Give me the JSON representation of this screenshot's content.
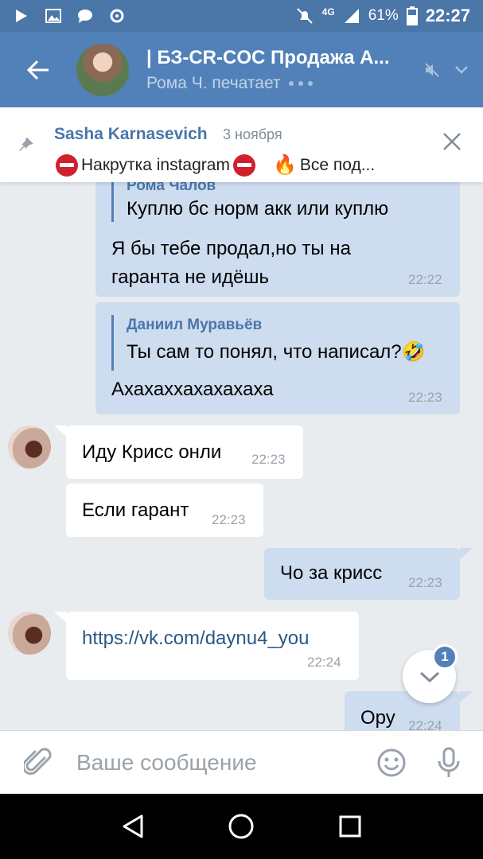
{
  "status_bar": {
    "network": "4G",
    "battery": "61%",
    "time": "22:27"
  },
  "header": {
    "title": "| БЗ-CR-COC Продажа А...",
    "subtitle": "Рома Ч. печатает"
  },
  "pinned": {
    "author": "Sasha Karnasevich",
    "date": "3 ноября",
    "text_1": "Накрутка instagram",
    "text_2": "Все под..."
  },
  "messages": {
    "m1": {
      "quote_author": "Рома Чалов",
      "quote_text": "Куплю бс норм акк или куплю",
      "line_1": "Я бы тебе продал,но ты на",
      "line_2": "гаранта не идёшь",
      "time": "22:22"
    },
    "m2": {
      "quote_author": "Даниил Муравьёв",
      "quote_text": "Ты сам то понял, что написал?",
      "text": "Ахахаххахахахаха",
      "time": "22:23"
    },
    "m3": {
      "text": "Иду Крисс онли",
      "time": "22:23"
    },
    "m4": {
      "text": "Если гарант",
      "time": "22:23"
    },
    "m5": {
      "text": "Чо за крисс",
      "time": "22:23"
    },
    "m6": {
      "text": "https://vk.com/daynu4_you",
      "time": "22:24"
    },
    "m7": {
      "text": "Ору",
      "time": "22:24"
    }
  },
  "scroll_badge": "1",
  "composer": {
    "placeholder": "Ваше сообщение"
  },
  "colors": {
    "header": "#5181b8",
    "status_bar": "#4a76a8",
    "outgoing_bubble": "#cddcef",
    "incoming_bubble": "#ffffff",
    "background": "#e9ecef"
  },
  "icons": [
    "back-arrow-icon",
    "mute-icon",
    "chevron-down-icon",
    "pin-icon",
    "close-icon",
    "paperclip-icon",
    "smiley-icon",
    "microphone-icon",
    "nav-back-icon",
    "nav-home-icon",
    "nav-recents-icon"
  ]
}
